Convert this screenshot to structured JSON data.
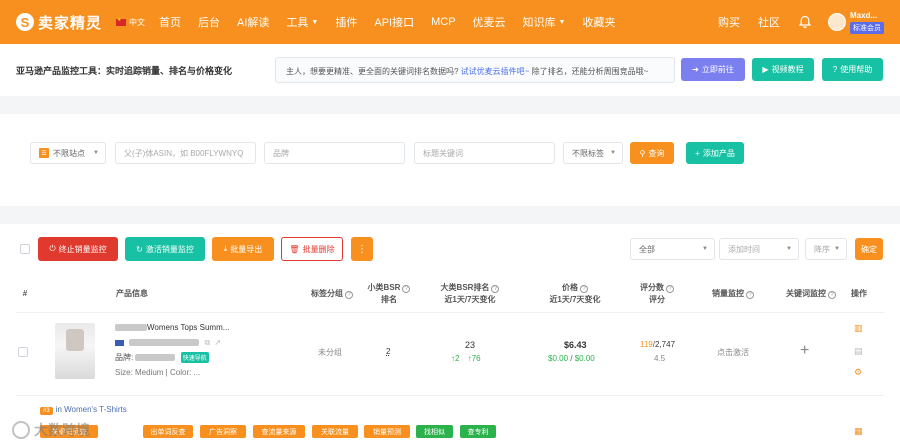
{
  "brand": {
    "logo_letter": "S",
    "name": "卖家精灵"
  },
  "lang": "中文",
  "nav": {
    "items": [
      {
        "label": "首页"
      },
      {
        "label": "后台"
      },
      {
        "label": "AI解读"
      },
      {
        "label": "工具"
      },
      {
        "label": "插件"
      },
      {
        "label": "API接口"
      },
      {
        "label": "MCP"
      },
      {
        "label": "优麦云"
      },
      {
        "label": "知识库"
      },
      {
        "label": "收藏夹"
      }
    ]
  },
  "nav_right": {
    "buy": "购买",
    "community": "社区"
  },
  "user": {
    "name": "Maxd...",
    "badge": "标准会员"
  },
  "intro": {
    "title": "亚马逊产品监控工具：实时追踪销量、排名与价格变化",
    "hint_prefix": "主人，想要更精准、更全面的关键词排名数据吗? ",
    "hint_link": "试试优麦云插件吧~",
    "hint_suffix": " 除了排名，还能分析周围竞品哦~",
    "btn_go": "立即前往",
    "btn_video": "视频教程",
    "btn_help": "使用帮助"
  },
  "filters": {
    "site": "不限站点",
    "asin_placeholder": "父(子)体ASIN，如 B00FLYWNYQ",
    "brand_placeholder": "品牌",
    "keyword_placeholder": "标题关键词",
    "label_select": "不限标签",
    "query": "查询",
    "add_product": "添加产品"
  },
  "toolbar": {
    "stop": "终止销量监控",
    "activate": "激活销量监控",
    "export": "批量导出",
    "delete": "批量删除",
    "more": "⋮",
    "scope": "全部",
    "sort_field": "添加时间",
    "order": "降序",
    "confirm": "确定"
  },
  "table": {
    "headers": {
      "num": "#",
      "product": "产品信息",
      "tag_group": "标签分组",
      "sub_bsr_1": "小类BSR",
      "sub_bsr_2": "排名",
      "main_bsr_1": "大类BSR排名",
      "main_bsr_2": "近1天/7天变化",
      "price_1": "价格",
      "price_2": "近1天/7天变化",
      "rating_1": "评分数",
      "rating_2": "评分",
      "sales_monitor": "销量监控",
      "kw_monitor": "关键词监控",
      "actions": "操作"
    },
    "row": {
      "title": "Womens Tops Summ...",
      "brand_label": "品牌:",
      "fast_tag": "快速导航",
      "size_color": "Size: Medium | Color: ...",
      "tag_group": "未分组",
      "sub_bsr": "2",
      "main_bsr": "23",
      "bsr_change_1d": "↑2",
      "bsr_change_7d": "↑76",
      "price": "$6.43",
      "price_change_1d": "$0.00",
      "price_sep": "/",
      "price_change_7d": "$0.00",
      "rating_count_1d": "119",
      "rating_sep": "/",
      "rating_count_7d": "2,747",
      "rating": "4.5",
      "sales_action": "点击激活",
      "kw_action": "+",
      "rank_badge": "#3",
      "category": "in Women's T-Shirts"
    },
    "tag_buttons": [
      {
        "label": "关键词反查",
        "color": "#f7901e"
      },
      {
        "label": "出单词反查",
        "color": "#f7901e"
      },
      {
        "label": "广告洞察",
        "color": "#f7901e"
      },
      {
        "label": "查流量来源",
        "color": "#f7901e"
      },
      {
        "label": "关联流量",
        "color": "#f7901e"
      },
      {
        "label": "销量预测",
        "color": "#f7901e"
      },
      {
        "label": "找相似",
        "color": "#2bb24c"
      },
      {
        "label": "查专利",
        "color": "#2bb24c"
      }
    ]
  },
  "watermark": "大数跨境",
  "colors": {
    "brand_orange": "#f7901e",
    "teal": "#18c1a3",
    "purple": "#7b7ff0",
    "red": "#e03a2f",
    "green": "#2bb24c"
  }
}
